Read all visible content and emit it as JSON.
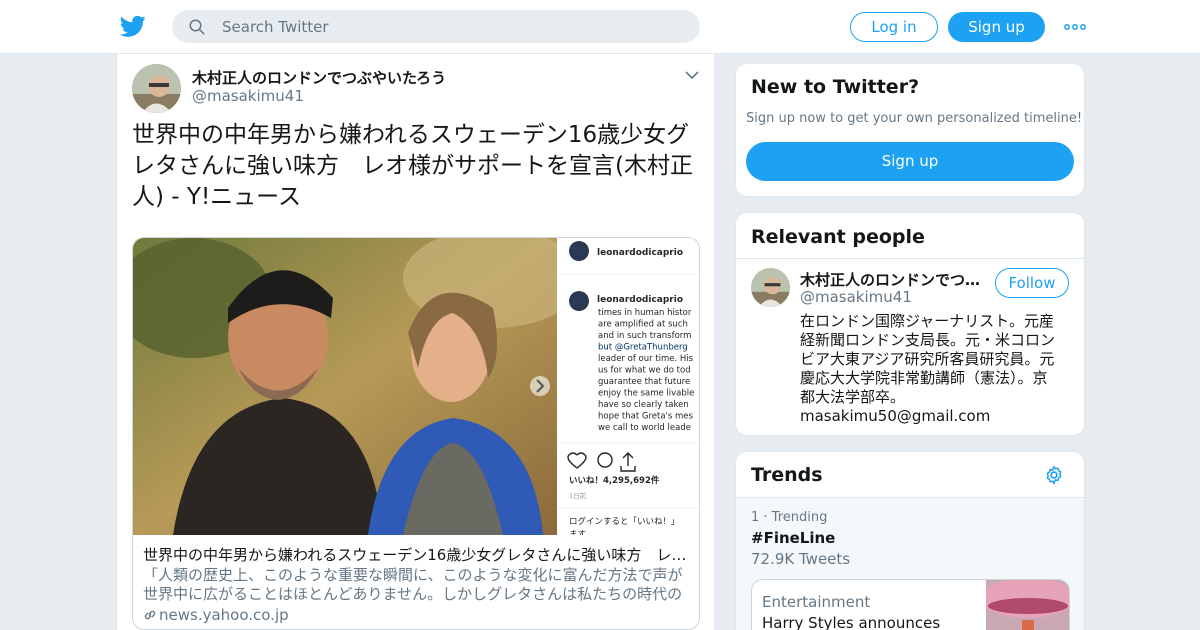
{
  "topbar": {
    "logo_icon": "twitter-bird-icon",
    "search_placeholder": "Search Twitter",
    "login_label": "Log in",
    "signup_label": "Sign up",
    "more_icon": "more-dots-icon",
    "accent": "#1da1f2"
  },
  "tweet": {
    "author_name": "木村正人のロンドンでつぶやいたろう",
    "author_handle": "@masakimu41",
    "text": "世界中の中年男から嫌われるスウェーデン16歳少女グレタさんに強い味方　レオ様がサポートを宣言(木村正人) - Y!ニュース",
    "card": {
      "title": "世界中の中年男から嫌われるスウェーデン16歳少女グレタさんに強い味方　レオ様がサポートを宣言",
      "description": "「人類の歴史上、このような重要な瞬間に、このような変化に富んだ方法で声が世界中に広がることはほとんどありません。しかしグレタさんは私たちの時代のリーダーです」",
      "domain": "news.yahoo.co.jp",
      "image": {
        "username": "leonardodicaprio",
        "caption_lines": [
          "times in human histor",
          "are amplified at such",
          "and in such transform",
          "but @GretaThunberg",
          "leader of our time. His",
          "us for what we do tod",
          "guarantee that future",
          "enjoy the same livable",
          "have so clearly taken",
          "hope that Greta's mes",
          "we call to world leade"
        ],
        "likes": "いいね！4,295,692件",
        "age": "1日前",
        "login_prompt": "ログインすると「いいね！」",
        "login_prompt_tail": "ます"
      }
    }
  },
  "new_to_twitter": {
    "title": "New to Twitter?",
    "subtitle": "Sign up now to get your own personalized timeline!",
    "signup_label": "Sign up"
  },
  "relevant_people": {
    "title": "Relevant people",
    "name": "木村正人のロンドンでつぶやいたろう",
    "handle": "@masakimu41",
    "follow_label": "Follow",
    "bio": "在ロンドン国際ジャーナリスト。元産\n経新聞ロンドン支局長。元・米コロン\nビア大東アジア研究所客員研究員。元\n慶応大大学院非常勤講師（憲法）。京\n都大法学部卒。\nmasakimu50@gmail.com"
  },
  "trends": {
    "title": "Trends",
    "settings_icon": "gear-icon",
    "items": [
      {
        "meta": "1 · Trending",
        "name": "#FineLine",
        "count": "72.9K Tweets"
      }
    ],
    "news": {
      "category": "Entertainment",
      "title": "Harry Styles announces"
    }
  }
}
